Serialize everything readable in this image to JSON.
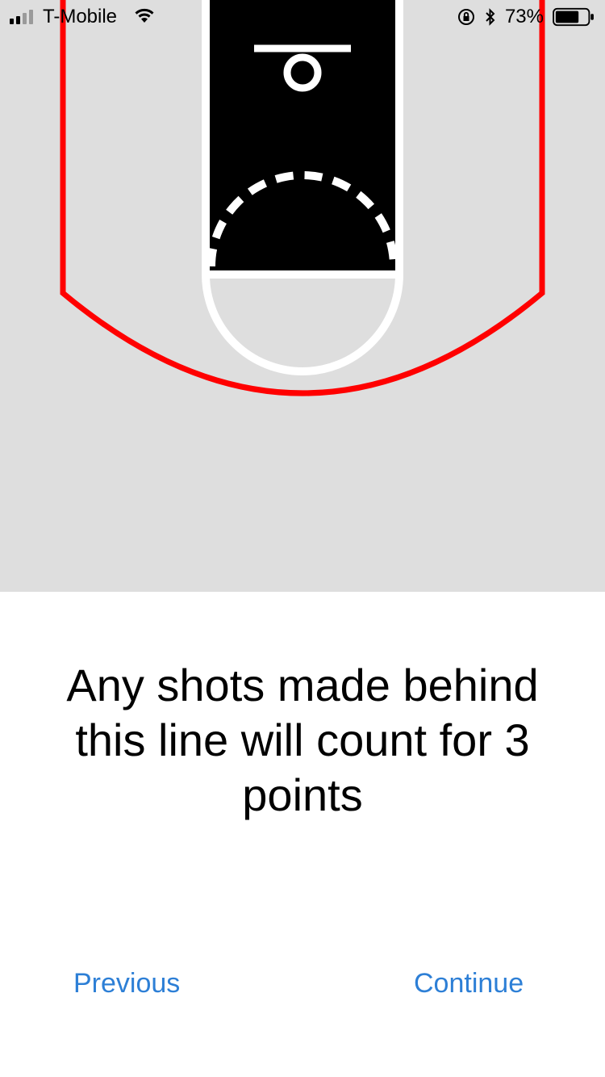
{
  "status_bar": {
    "carrier": "T-Mobile",
    "battery": "73%",
    "signal_bars_filled": 2,
    "signal_bars_total": 4,
    "battery_level": 0.73,
    "icons": [
      "wifi-icon",
      "orientation-lock-icon",
      "bluetooth-icon",
      "battery-icon"
    ]
  },
  "court": {
    "background_color": "#dedede",
    "paint_color": "#000000",
    "line_color": "#ffffff",
    "three_point_line_color": "#ff0000"
  },
  "message": "Any shots made behind this line will count for 3 points",
  "buttons": {
    "previous": "Previous",
    "continue": "Continue"
  },
  "accent_color": "#2d7fd6"
}
